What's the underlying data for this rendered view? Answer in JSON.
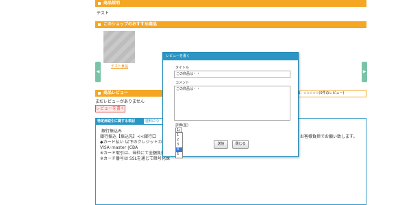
{
  "sections": {
    "description_header": "商品説明",
    "description_body": "テスト",
    "recommend_header": "このショップのおすすめ商品",
    "recommend_link": "テスト食品",
    "review_header": "商品レビュー",
    "no_review": "まだレビューがありません",
    "review_button": "レビューを書く",
    "rating_summary": "価：☆☆☆☆☆(0件のレビュー)"
  },
  "tabs": [
    {
      "label": "特定商取引に関する表記"
    },
    {
      "label": "送料につ"
    }
  ],
  "tab_content": {
    "line1": "銀行振込み",
    "line2": "銀行振込【振込先】<<銀行口",
    "line3": "◆カード払い 以下のクレジットカード会",
    "line4": "VISA･master･JCBA",
    "line5": "※カード取引は、当社にて全額負担",
    "line6": "※カード番号は SSLを通じて暗号化保",
    "right_fragment": "お客様負担でお願い致します。"
  },
  "modal": {
    "title": "レビューを書く",
    "title_label": "タイトル",
    "title_value": "この商品は・・",
    "comment_label": "コメント",
    "comment_value": "この商品は・・",
    "rating_label": "評価(星)",
    "rating_selected": "1",
    "rating_options": [
      "1",
      "2",
      "3",
      "4",
      "5"
    ],
    "submit_label": "送信",
    "close_label": "閉じる"
  },
  "colors": {
    "accent": "#f5a623",
    "modal_header": "#2b96c4",
    "arrow": "#79c3a8",
    "button_red": "#e04c4c"
  }
}
